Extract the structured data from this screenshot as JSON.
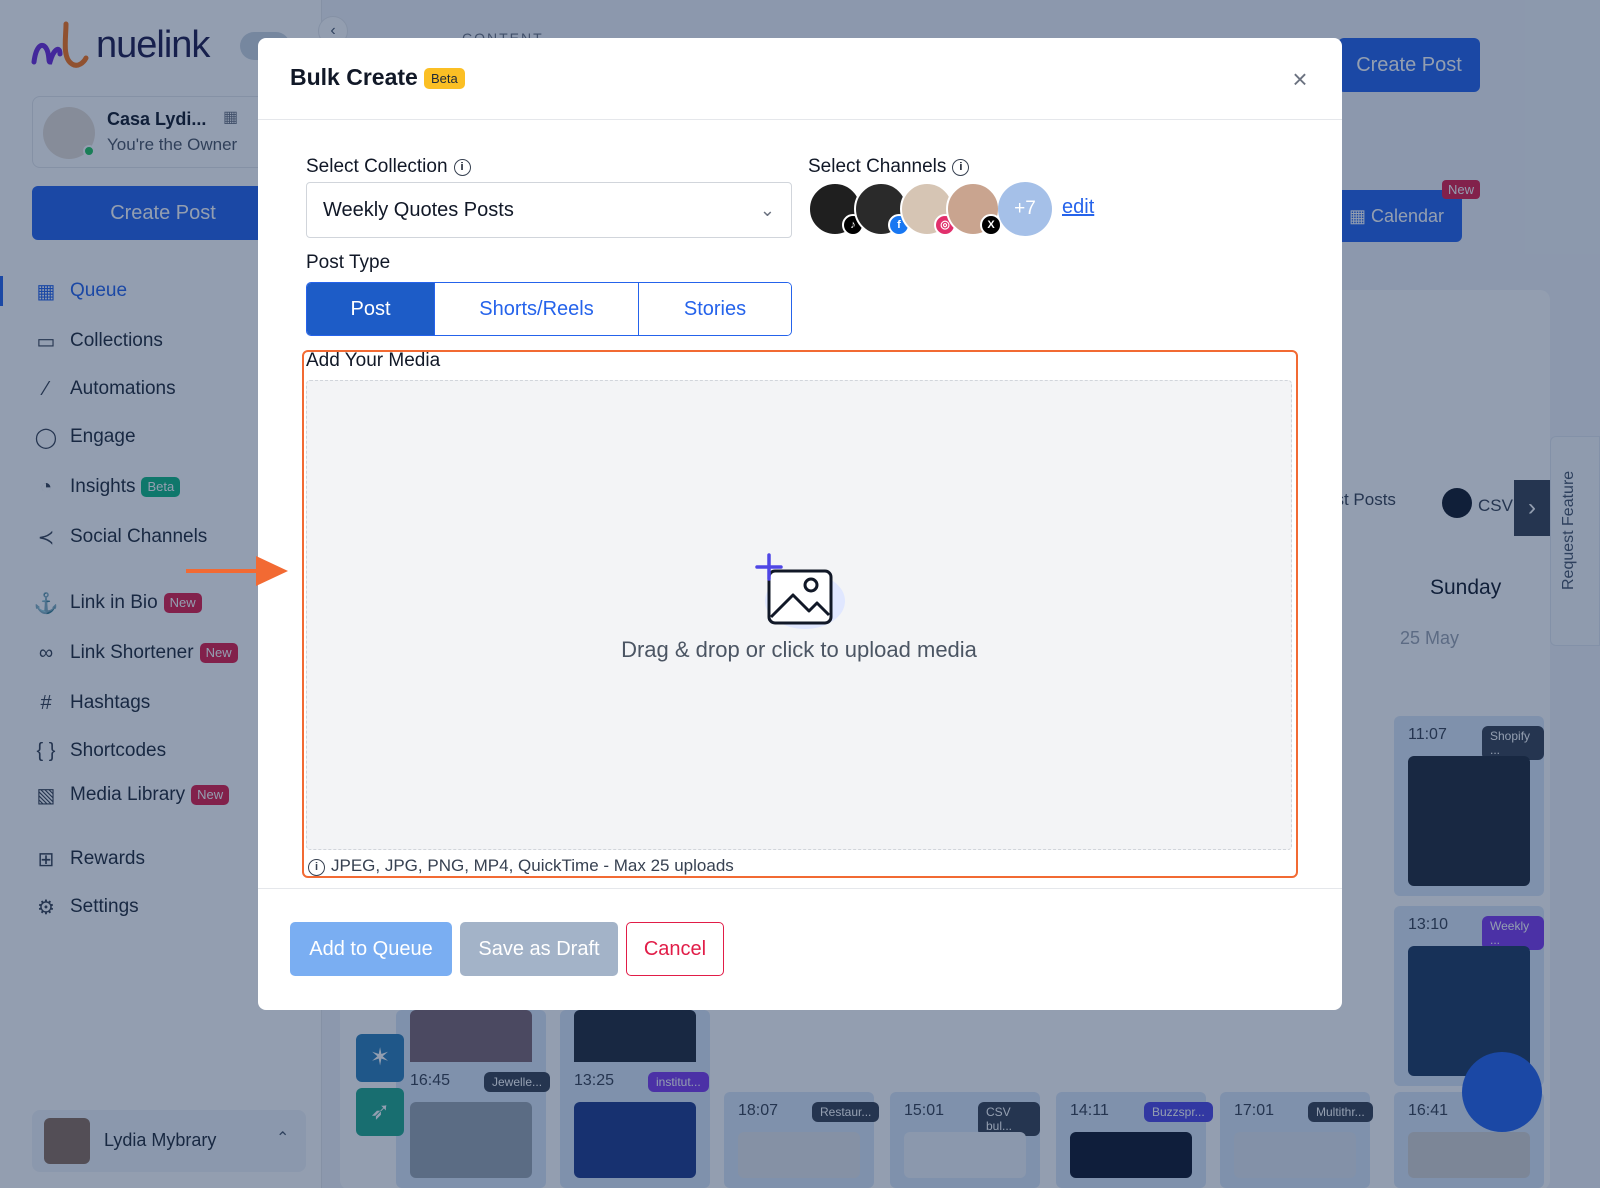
{
  "app": {
    "logo_text": "nuelink"
  },
  "sidebar": {
    "account_name": "Casa Lydi...",
    "account_role": "You're the Owner",
    "create_label": "Create Post",
    "items": [
      {
        "label": "Queue",
        "icon": "calendar-icon"
      },
      {
        "label": "Collections",
        "icon": "folder-icon"
      },
      {
        "label": "Automations",
        "icon": "magic-wand-icon"
      },
      {
        "label": "Engage",
        "icon": "chat-bubble-icon"
      },
      {
        "label": "Insights",
        "icon": "pie-chart-icon",
        "badge": "Beta"
      },
      {
        "label": "Social Channels",
        "icon": "share-icon"
      },
      {
        "label": "Link in Bio",
        "icon": "anchor-icon",
        "badge": "New"
      },
      {
        "label": "Link Shortener",
        "icon": "link-icon",
        "badge": "New"
      },
      {
        "label": "Hashtags",
        "icon": "hash-icon"
      },
      {
        "label": "Shortcodes",
        "icon": "braces-icon"
      },
      {
        "label": "Media Library",
        "icon": "image-stack-icon",
        "badge": "New"
      },
      {
        "label": "Rewards",
        "icon": "gift-icon"
      },
      {
        "label": "Settings",
        "icon": "gear-icon"
      }
    ],
    "user_name": "Lydia Mybrary"
  },
  "background": {
    "content_label": "CONTENT",
    "create_label": "Create Post",
    "calendar_label": "Calendar",
    "new_badge": "New",
    "tab_partial": "ast Posts",
    "tab_csv": "CSV bu",
    "day_name": "Sunday",
    "day_date": "25 May",
    "request_feature": "Request Feature",
    "cards": [
      {
        "time": "11:07",
        "tag": "Shopify ..."
      },
      {
        "time": "13:10",
        "tag": "Weekly ..."
      },
      {
        "time": "16:45",
        "tag": "Jewelle..."
      },
      {
        "time": "13:25",
        "tag": "institut..."
      },
      {
        "time": "18:07",
        "tag": "Restaur..."
      },
      {
        "time": "15:01",
        "tag": "CSV bul..."
      },
      {
        "time": "14:11",
        "tag": "Buzzspr..."
      },
      {
        "time": "17:01",
        "tag": "Multithr..."
      },
      {
        "time": "16:41",
        "tag": ""
      }
    ]
  },
  "modal": {
    "title": "Bulk Create",
    "badge": "Beta",
    "close": "×",
    "collection_label": "Select Collection",
    "collection_value": "Weekly Quotes Posts",
    "channels_label": "Select Channels",
    "channels_more": "+7",
    "channels_edit": "edit",
    "post_type_label": "Post Type",
    "post_types": [
      "Post",
      "Shorts/Reels",
      "Stories"
    ],
    "media_label": "Add Your Media",
    "drop_text": "Drag & drop or click to upload media",
    "hint": "JPEG, JPG, PNG, MP4, QuickTime - Max 25 uploads",
    "add_queue": "Add to Queue",
    "save_draft": "Save as Draft",
    "cancel": "Cancel"
  },
  "colors": {
    "accent": "#2563eb",
    "highlight": "#f26a33",
    "danger": "#e11d48"
  }
}
